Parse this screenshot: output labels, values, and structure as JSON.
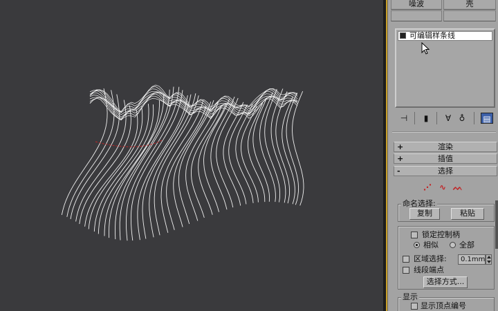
{
  "panel": {
    "top_buttons": [
      "噪波",
      "壳"
    ],
    "modifier_stack": {
      "selected_item": "可编辑样条线"
    },
    "stack_toolbar_icons": [
      "pin-stack-icon",
      "show-end-result-icon",
      "make-unique-icon",
      "remove-modifier-icon",
      "configure-modifier-sets-icon"
    ],
    "rollouts": {
      "render": {
        "sign": "+",
        "label": "渲染"
      },
      "interpolation": {
        "sign": "+",
        "label": "插值"
      },
      "selection": {
        "sign": "-",
        "label": "选择"
      }
    },
    "selection_level_icons": [
      "vertex-level-icon",
      "segment-level-icon",
      "spline-level-icon"
    ],
    "named_selections": {
      "title": "命名选择:",
      "copy_label": "复制",
      "paste_label": "粘贴"
    },
    "lock_handles": {
      "checkbox_label": "锁定控制柄",
      "alike_label": "相似",
      "all_label": "全部",
      "selected_radio": "alike"
    },
    "area_selection": {
      "label": "区域选择:",
      "value": "0.1mm"
    },
    "segment_end": {
      "label": "线段端点"
    },
    "select_by_label": "选择方式...",
    "display": {
      "title": "显示",
      "show_vertex_numbers_label": "显示顶点编号"
    }
  },
  "colors": {
    "viewport_bg": "#3a3a3d",
    "wire": "#f2f2f2",
    "selection_accent": "#c0282a",
    "panel_bg": "#a3a3a3",
    "active_border": "#caa12a"
  }
}
